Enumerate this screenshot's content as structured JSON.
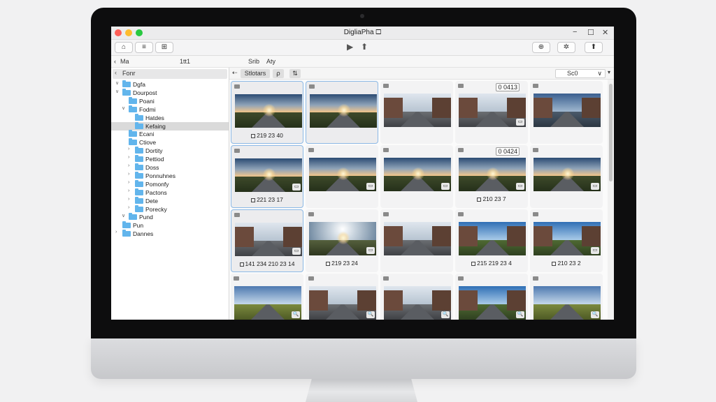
{
  "window": {
    "title": "DigliaPha 🞏",
    "controls": {
      "minimize": "−",
      "maximize": "☐",
      "close": "✕"
    }
  },
  "toolbar": {
    "home_icon": "⌂",
    "menu_icon": "≡",
    "table_icon": "⊞",
    "play_icon": "▶",
    "tree_icon": "⬆",
    "right_icons": [
      "⊕",
      "✲",
      "⬆"
    ]
  },
  "pathbar": {
    "back_label": "‹",
    "crumb1": "Ma",
    "crumb2": "1tt1",
    "menu1": "Srib",
    "menu2": "Aty"
  },
  "sidebar": {
    "search_label": "Fonr",
    "close_label": "✕",
    "items": [
      {
        "label": "Dgfa",
        "indent": 0,
        "disclosure": "∨"
      },
      {
        "label": "Dourpost",
        "indent": 0,
        "disclosure": "∨"
      },
      {
        "label": "Poani",
        "indent": 1,
        "disclosure": ""
      },
      {
        "label": "Fodmi",
        "indent": 1,
        "disclosure": "∨"
      },
      {
        "label": "Hatdes",
        "indent": 2,
        "disclosure": ""
      },
      {
        "label": "Kefaing",
        "indent": 2,
        "disclosure": "",
        "selected": true
      },
      {
        "label": "Ecani",
        "indent": 1,
        "disclosure": ""
      },
      {
        "label": "Ctiove",
        "indent": 1,
        "disclosure": ""
      },
      {
        "label": "Dortity",
        "indent": 2,
        "disclosure": "›"
      },
      {
        "label": "Pettiod",
        "indent": 2,
        "disclosure": "›"
      },
      {
        "label": "Doss",
        "indent": 2,
        "disclosure": "›"
      },
      {
        "label": "Ponnuhnes",
        "indent": 2,
        "disclosure": "›"
      },
      {
        "label": "Pomonfy",
        "indent": 2,
        "disclosure": "›"
      },
      {
        "label": "Pactons",
        "indent": 2,
        "disclosure": "›"
      },
      {
        "label": "Dete",
        "indent": 2,
        "disclosure": "›"
      },
      {
        "label": "Porecky",
        "indent": 2,
        "disclosure": "›"
      },
      {
        "label": "Pund",
        "indent": 1,
        "disclosure": "∨"
      },
      {
        "label": "Pun",
        "indent": 0,
        "disclosure": ""
      },
      {
        "label": "Dannes",
        "indent": 0,
        "disclosure": "›"
      }
    ]
  },
  "content_bar": {
    "back_icon": "⇠",
    "tab_active": "Stlotars",
    "tab2": "⍴",
    "tab3": "⇅",
    "sort_label": "Sc0",
    "sort_chevron": "∨",
    "more_icon": "▾"
  },
  "grid": {
    "tiles": [
      {
        "caption": "219 23 40",
        "selected": true,
        "badge": "",
        "scene": "sunset",
        "corner": ""
      },
      {
        "caption": "",
        "selected": true,
        "badge": "",
        "scene": "sunset",
        "corner": ""
      },
      {
        "caption": "",
        "selected": false,
        "badge": "",
        "scene": "street",
        "corner": ""
      },
      {
        "caption": "",
        "selected": false,
        "badge": "0 0413",
        "scene": "street",
        "corner": "▭"
      },
      {
        "caption": "",
        "selected": false,
        "badge": "",
        "scene": "dusk",
        "corner": ""
      },
      {
        "caption": "221 23 17",
        "selected": true,
        "badge": "",
        "scene": "sunset",
        "corner": "▭"
      },
      {
        "caption": "",
        "selected": false,
        "badge": "",
        "scene": "sunset",
        "corner": "▭"
      },
      {
        "caption": "",
        "selected": false,
        "badge": "",
        "scene": "sunset",
        "corner": "▭"
      },
      {
        "caption": "210 23 7",
        "selected": false,
        "badge": "0 0424",
        "scene": "sunset",
        "corner": "▭"
      },
      {
        "caption": "",
        "selected": false,
        "badge": "",
        "scene": "sunset",
        "corner": "▭"
      },
      {
        "caption": "141 234 210 23 14",
        "selected": true,
        "badge": "",
        "scene": "street",
        "corner": "▭"
      },
      {
        "caption": "219 23 24",
        "selected": false,
        "badge": "",
        "scene": "bright",
        "corner": "▭"
      },
      {
        "caption": "",
        "selected": false,
        "badge": "",
        "scene": "street",
        "corner": ""
      },
      {
        "caption": "215 219 23 4",
        "selected": false,
        "badge": "",
        "scene": "day",
        "corner": ""
      },
      {
        "caption": "210 23 2",
        "selected": false,
        "badge": "",
        "scene": "day",
        "corner": "▭"
      },
      {
        "caption": "",
        "selected": false,
        "badge": "",
        "scene": "field",
        "corner": "🔍"
      },
      {
        "caption": "",
        "selected": false,
        "badge": "",
        "scene": "street",
        "corner": "🔍"
      },
      {
        "caption": "",
        "selected": false,
        "badge": "",
        "scene": "street",
        "corner": "🔍"
      },
      {
        "caption": "",
        "selected": false,
        "badge": "",
        "scene": "day",
        "corner": "🔍"
      },
      {
        "caption": "",
        "selected": false,
        "badge": "",
        "scene": "field",
        "corner": "🔍"
      }
    ]
  },
  "colors": {
    "folder": "#62b5ec",
    "selection_border": "#8cb9e6",
    "traffic_red": "#fe5f57",
    "traffic_yellow": "#febc2e",
    "traffic_green": "#28c840"
  }
}
